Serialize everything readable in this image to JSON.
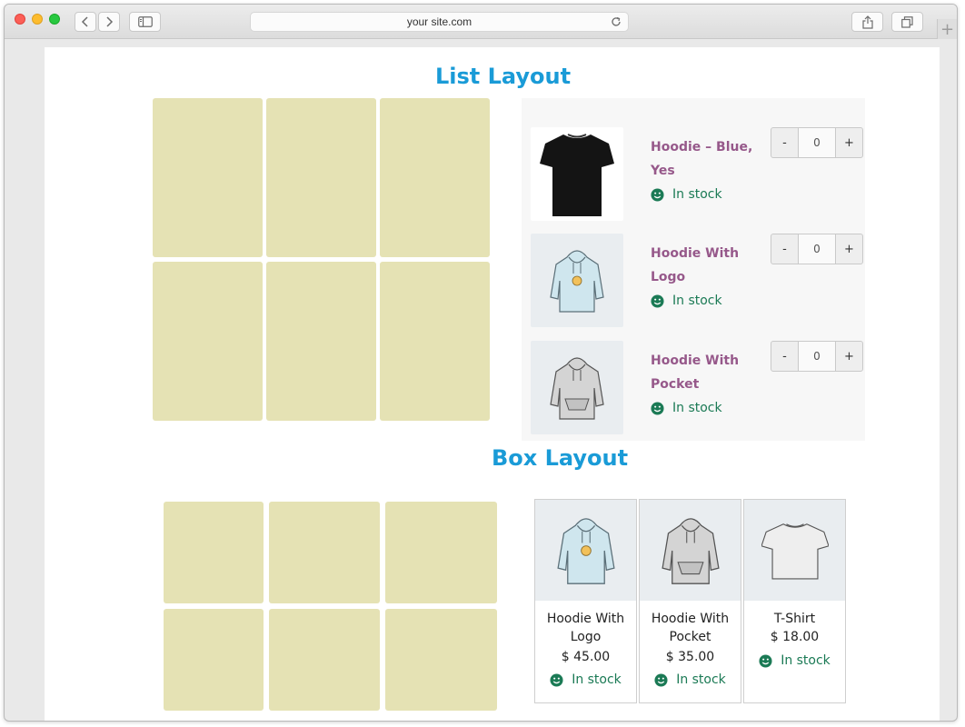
{
  "browser": {
    "address": "your site.com",
    "new_tab_symbol": "+"
  },
  "list_layout": {
    "title": "List Layout",
    "products": [
      {
        "name": "Hoodie – Blue, Yes",
        "stock": "In stock",
        "quantity": "0",
        "minus": "-",
        "plus": "+",
        "image": "black-tshirt-icon"
      },
      {
        "name": "Hoodie With Logo",
        "stock": "In stock",
        "quantity": "0",
        "minus": "-",
        "plus": "+",
        "image": "hoodie-logo-icon"
      },
      {
        "name": "Hoodie With Pocket",
        "stock": "In stock",
        "quantity": "0",
        "minus": "-",
        "plus": "+",
        "image": "hoodie-pocket-icon"
      }
    ]
  },
  "box_layout": {
    "title": "Box Layout",
    "products": [
      {
        "name": "Hoodie With Logo",
        "price": "$ 45.00",
        "stock": "In stock",
        "image": "hoodie-logo-icon"
      },
      {
        "name": "Hoodie With Pocket",
        "price": "$ 35.00",
        "stock": "In stock",
        "image": "hoodie-pocket-icon"
      },
      {
        "name": "T-Shirt",
        "price": "$ 18.00",
        "stock": "In stock",
        "image": "tshirt-icon"
      }
    ]
  },
  "colors": {
    "title": "#1a9bd7",
    "product_name": "#96588a",
    "in_stock": "#1b7a55",
    "placeholder_tile": "#e5e2b4"
  }
}
